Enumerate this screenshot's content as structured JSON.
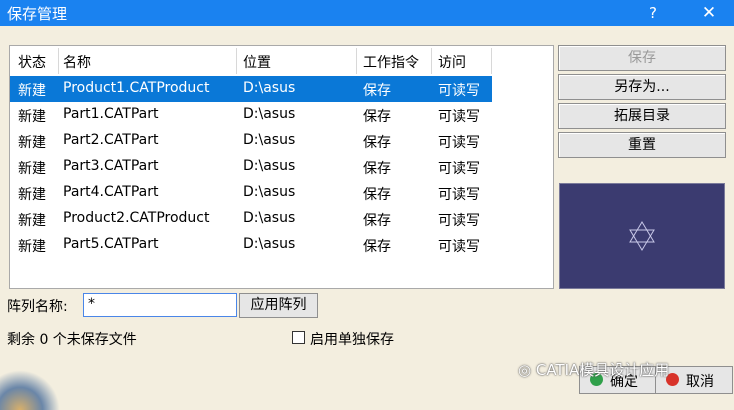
{
  "window": {
    "title": "保存管理",
    "help_glyph": "?",
    "close_glyph": "✕"
  },
  "table": {
    "headers": [
      "状态",
      "名称",
      "位置",
      "工作指令",
      "访问"
    ],
    "rows": [
      [
        "新建",
        "Product1.CATProduct",
        "D:\\asus",
        "保存",
        "可读写"
      ],
      [
        "新建",
        "Part1.CATPart",
        "D:\\asus",
        "保存",
        "可读写"
      ],
      [
        "新建",
        "Part2.CATPart",
        "D:\\asus",
        "保存",
        "可读写"
      ],
      [
        "新建",
        "Part3.CATPart",
        "D:\\asus",
        "保存",
        "可读写"
      ],
      [
        "新建",
        "Part4.CATPart",
        "D:\\asus",
        "保存",
        "可读写"
      ],
      [
        "新建",
        "Product2.CATProduct",
        "D:\\asus",
        "保存",
        "可读写"
      ],
      [
        "新建",
        "Part5.CATPart",
        "D:\\asus",
        "保存",
        "可读写"
      ]
    ],
    "selected_row": 0
  },
  "side_buttons": {
    "save": "保存",
    "save_as": "另存为...",
    "expand_dir": "拓展目录",
    "reset": "重置"
  },
  "array": {
    "label": "阵列名称:",
    "value": "*",
    "apply": "应用阵列"
  },
  "status": {
    "unsaved": "剩余 0 个未保存文件",
    "standalone_save": "启用单独保存"
  },
  "footer": {
    "ok": "确定",
    "cancel": "取消",
    "watermark": "CATIA模具设计应用"
  },
  "colors": {
    "titlebar": "#1a82f0",
    "selection": "#0a78d7",
    "preview_bg": "#3b3b70"
  }
}
